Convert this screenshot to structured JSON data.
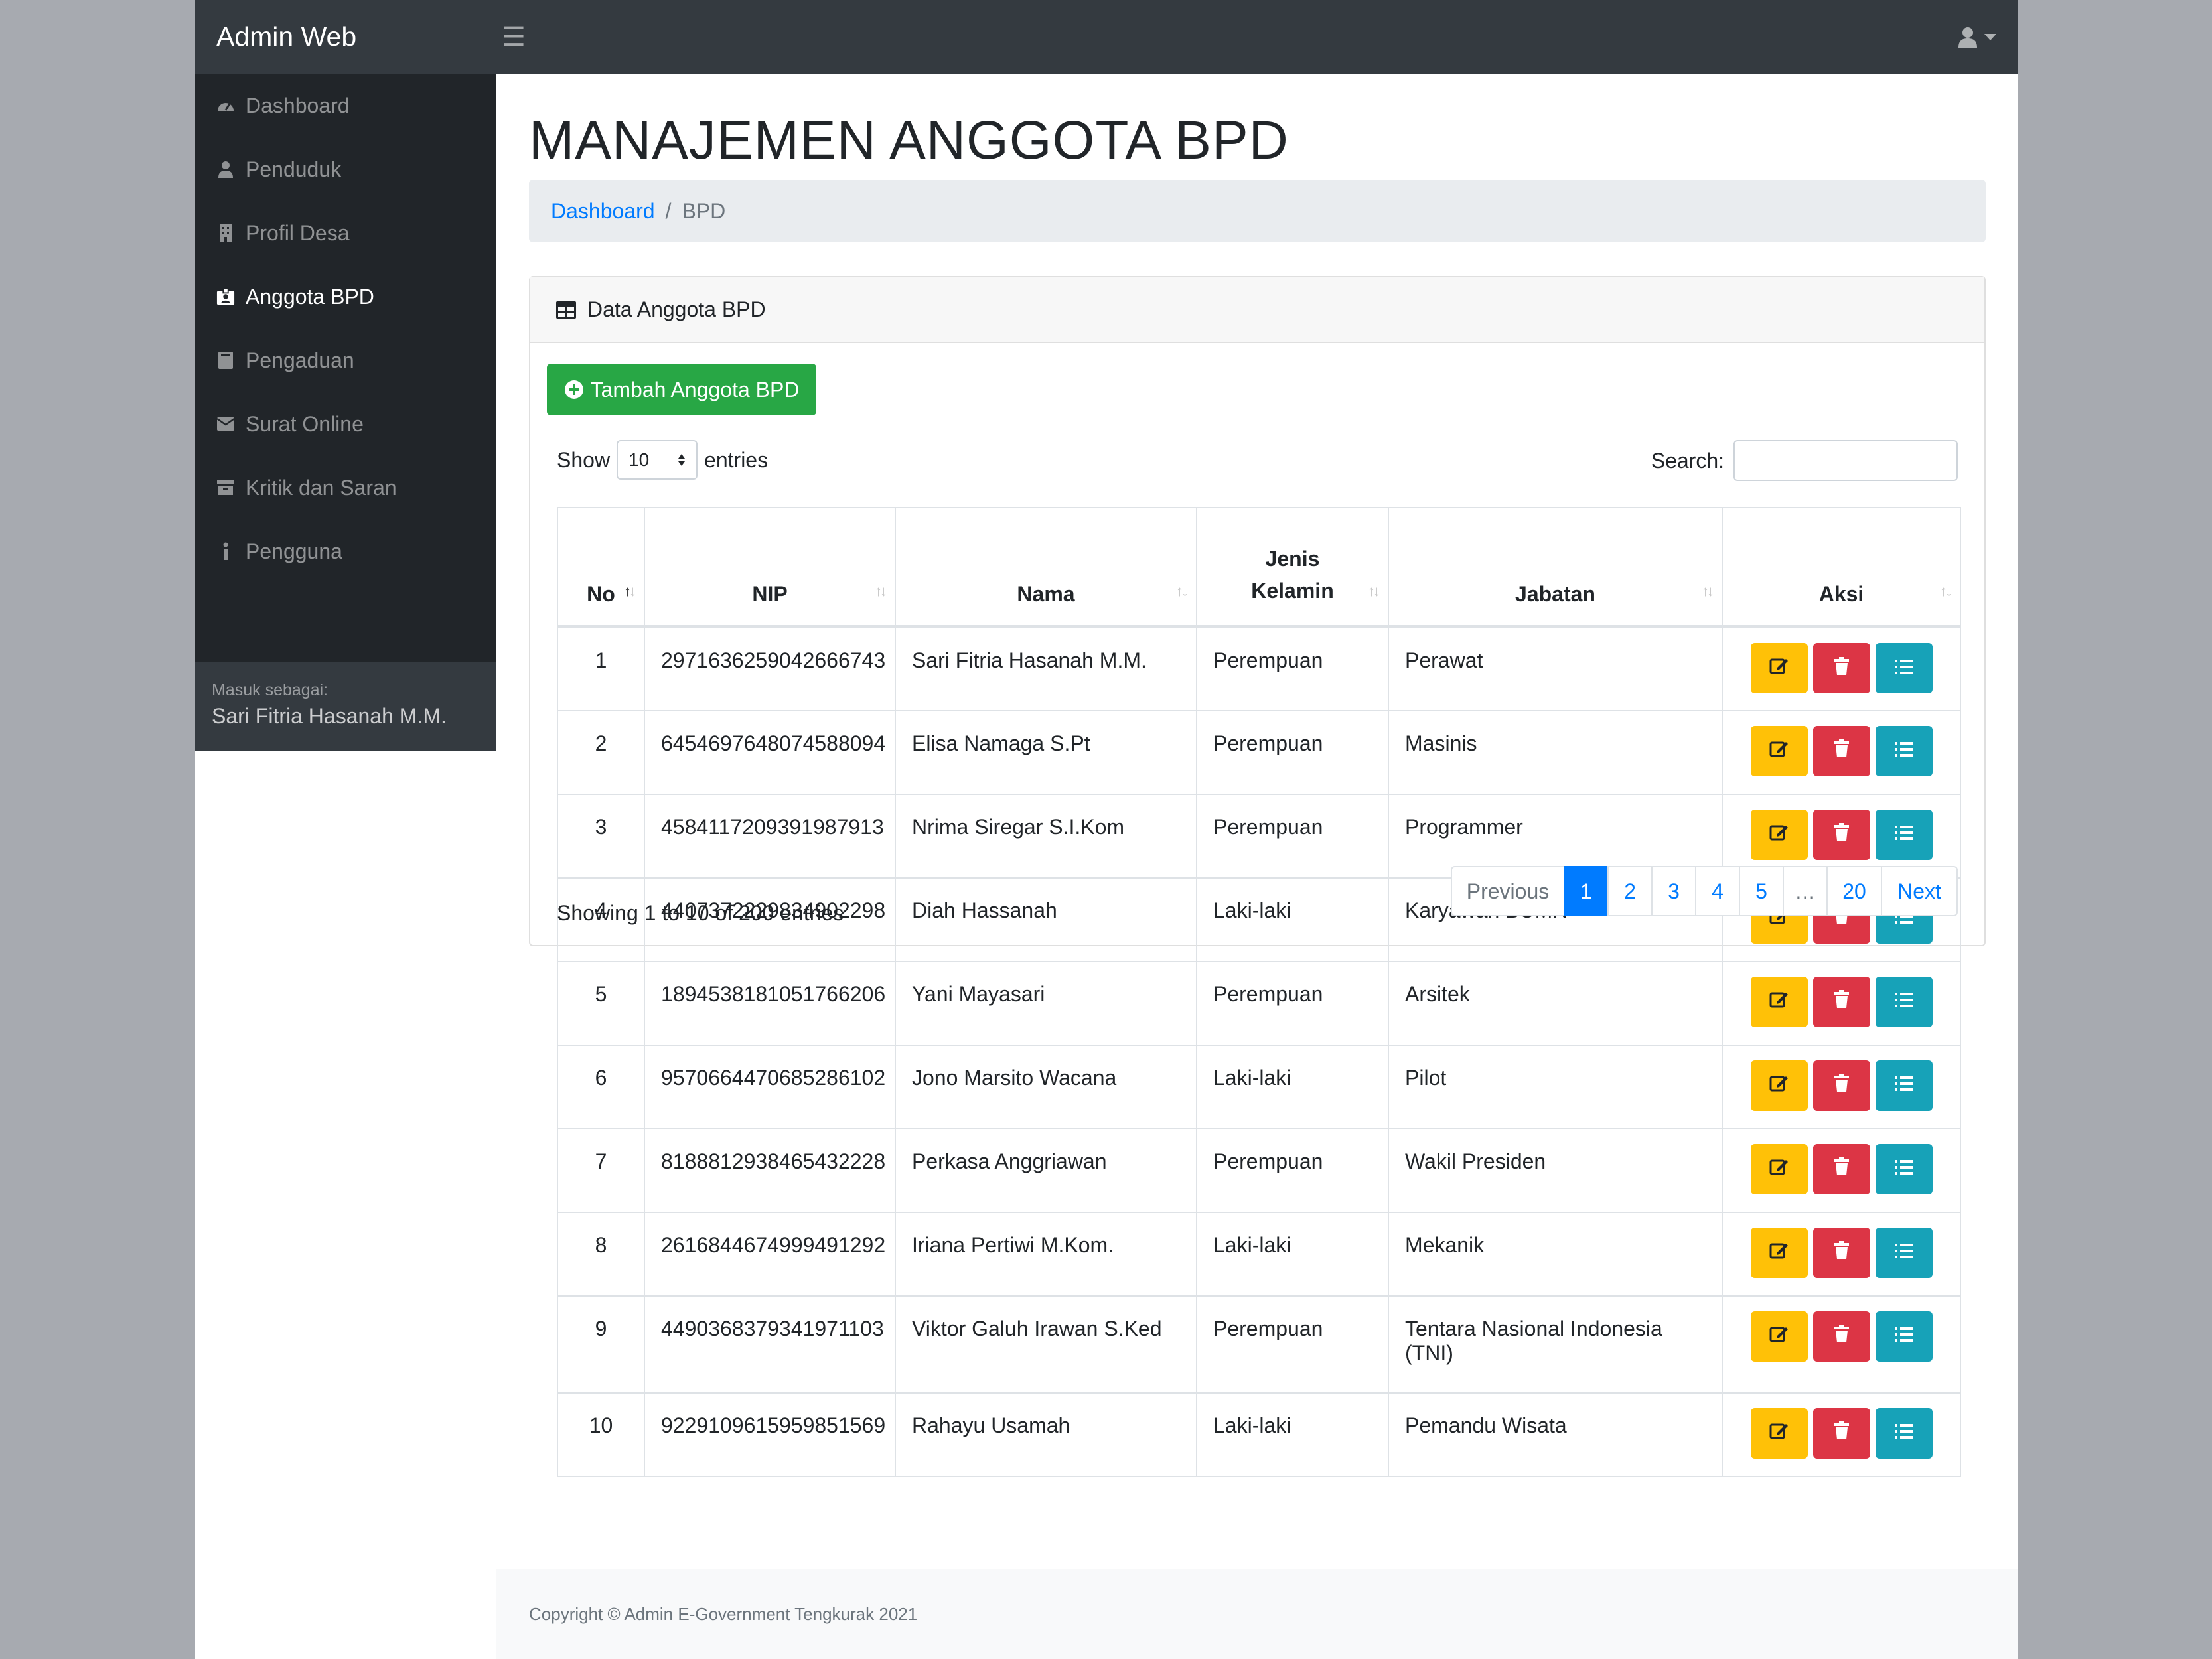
{
  "brand": "Admin Web",
  "sidebar": {
    "items": [
      {
        "label": "Dashboard",
        "icon": "tachometer-icon"
      },
      {
        "label": "Penduduk",
        "icon": "user-icon"
      },
      {
        "label": "Profil Desa",
        "icon": "building-icon"
      },
      {
        "label": "Anggota BPD",
        "icon": "id-badge-icon",
        "active": true
      },
      {
        "label": "Pengaduan",
        "icon": "book-icon"
      },
      {
        "label": "Surat Online",
        "icon": "envelope-icon"
      },
      {
        "label": "Kritik dan Saran",
        "icon": "archive-icon"
      },
      {
        "label": "Pengguna",
        "icon": "info-icon"
      }
    ],
    "footer_caption": "Masuk sebagai:",
    "footer_user": "Sari Fitria Hasanah M.M."
  },
  "page_title": "MANAJEMEN ANGGOTA BPD",
  "breadcrumb": {
    "home": "Dashboard",
    "separator": "/",
    "current": "BPD"
  },
  "card": {
    "header": "Data Anggota BPD",
    "add_button": "Tambah Anggota BPD",
    "show_label": "Show",
    "entries_value": "10",
    "entries_label": "entries",
    "search_label": "Search:",
    "search_value": ""
  },
  "table": {
    "headers": [
      "No",
      "NIP",
      "Nama",
      "Jenis Kelamin",
      "Jabatan",
      "Aksi"
    ],
    "rows": [
      {
        "no": "1",
        "nip": "2971636259042666743",
        "nama": "Sari Fitria Hasanah M.M.",
        "jk": "Perempuan",
        "jabatan": "Perawat"
      },
      {
        "no": "2",
        "nip": "6454697648074588094",
        "nama": "Elisa Namaga S.Pt",
        "jk": "Perempuan",
        "jabatan": "Masinis"
      },
      {
        "no": "3",
        "nip": "4584117209391987913",
        "nama": "Nrima Siregar S.I.Kom",
        "jk": "Perempuan",
        "jabatan": "Programmer"
      },
      {
        "no": "4",
        "nip": "4407372229834902298",
        "nama": "Diah Hassanah",
        "jk": "Laki-laki",
        "jabatan": "Karyawan BUMN"
      },
      {
        "no": "5",
        "nip": "1894538181051766206",
        "nama": "Yani Mayasari",
        "jk": "Perempuan",
        "jabatan": "Arsitek"
      },
      {
        "no": "6",
        "nip": "9570664470685286102",
        "nama": "Jono Marsito Wacana",
        "jk": "Laki-laki",
        "jabatan": "Pilot"
      },
      {
        "no": "7",
        "nip": "8188812938465432228",
        "nama": "Perkasa Anggriawan",
        "jk": "Perempuan",
        "jabatan": "Wakil Presiden"
      },
      {
        "no": "8",
        "nip": "2616844674999491292",
        "nama": "Iriana Pertiwi M.Kom.",
        "jk": "Laki-laki",
        "jabatan": "Mekanik"
      },
      {
        "no": "9",
        "nip": "4490368379341971103",
        "nama": "Viktor Galuh Irawan S.Ked",
        "jk": "Perempuan",
        "jabatan": "Tentara Nasional Indonesia (TNI)"
      },
      {
        "no": "10",
        "nip": "9229109615959851569",
        "nama": "Rahayu Usamah",
        "jk": "Laki-laki",
        "jabatan": "Pemandu Wisata"
      }
    ]
  },
  "info": "Showing 1 to 10 of 200 entries",
  "pagination": {
    "previous": "Previous",
    "pages": [
      "1",
      "2",
      "3",
      "4",
      "5",
      "…",
      "20"
    ],
    "active": "1",
    "next": "Next"
  },
  "footer": "Copyright © Admin E-Government Tengkurak 2021",
  "colors": {
    "navbar": "#343a40",
    "sidebar": "#212529",
    "success": "#28a745",
    "warning": "#ffc107",
    "danger": "#dc3545",
    "info": "#17a2b8",
    "primary": "#007bff"
  }
}
